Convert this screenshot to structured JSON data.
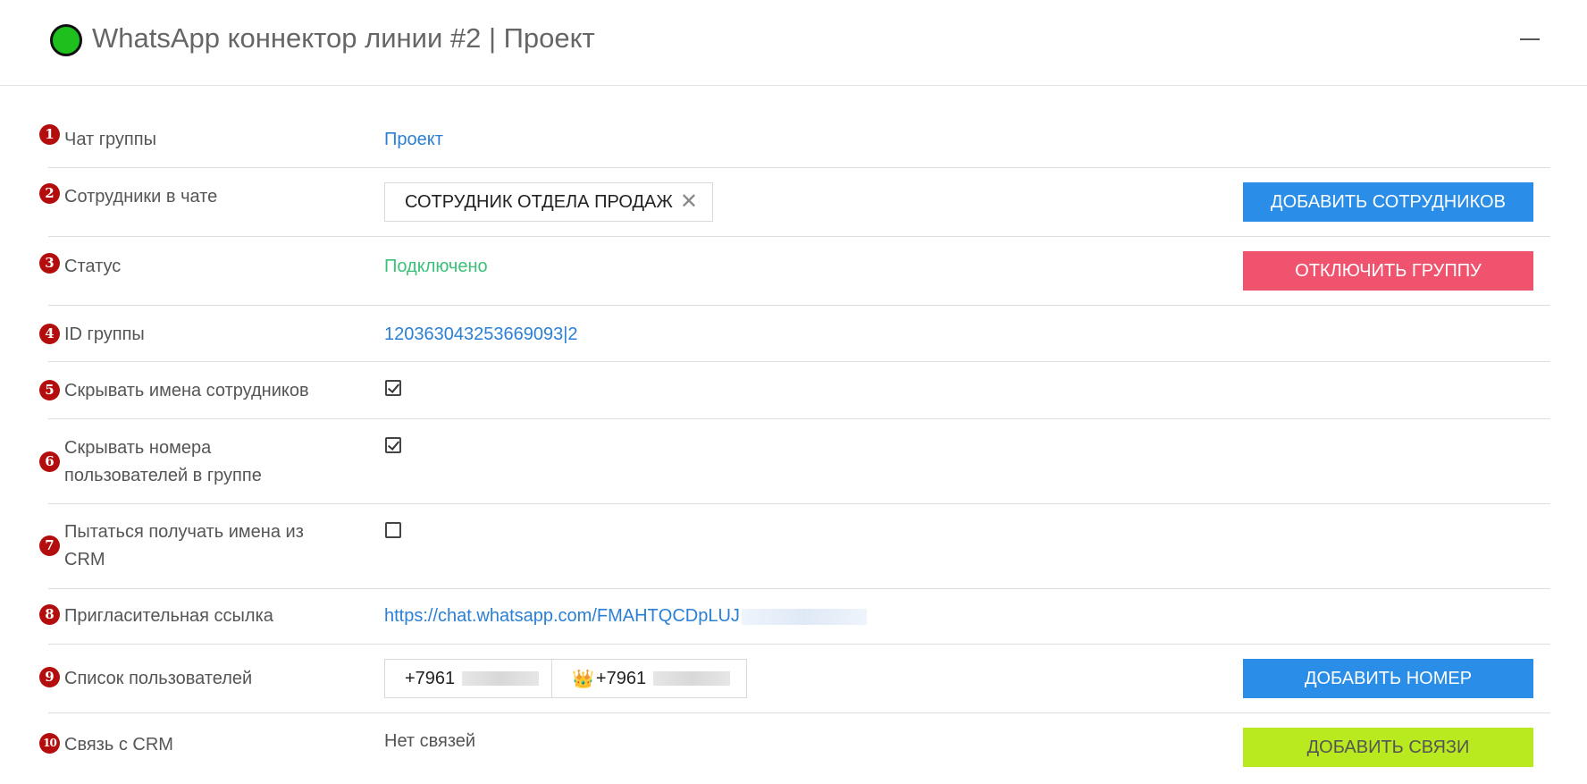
{
  "header": {
    "title": "WhatsApp коннектор линии #2 | Проект",
    "status_color": "#1ec01e",
    "minimize_icon": "minimize-icon"
  },
  "rows": {
    "chat_group": {
      "num": "1",
      "label": "Чат группы",
      "value": "Проект"
    },
    "employees": {
      "num": "2",
      "label": "Сотрудники в чате",
      "chip": "СОТРУДНИК ОТДЕЛА ПРОДАЖ",
      "button": "ДОБАВИТЬ СОТРУДНИКОВ"
    },
    "status": {
      "num": "3",
      "label": "Статус",
      "value": "Подключено",
      "button": "ОТКЛЮЧИТЬ ГРУППУ"
    },
    "group_id": {
      "num": "4",
      "label": "ID группы",
      "value": "120363043253669093|2"
    },
    "hide_names": {
      "num": "5",
      "label": "Скрывать имена сотрудников",
      "checked": true
    },
    "hide_numbers": {
      "num": "6",
      "label": "Скрывать номера пользователей в группе",
      "checked": true
    },
    "crm_names": {
      "num": "7",
      "label": "Пытаться получать имена из CRM",
      "checked": false
    },
    "invite_link": {
      "num": "8",
      "label": "Пригласительная ссылка",
      "value": "https://chat.whatsapp.com/FMAHTQCDpLUJ"
    },
    "users": {
      "num": "9",
      "label": "Список пользователей",
      "phones": [
        "+7961",
        "+7961"
      ],
      "button": "ДОБАВИТЬ НОМЕР"
    },
    "crm_link": {
      "num": "10",
      "label": "Связь с CRM",
      "value": "Нет связей",
      "button": "ДОБАВИТЬ СВЯЗИ"
    }
  },
  "colors": {
    "accent_blue": "#2a8de8",
    "danger_red": "#f0536e",
    "lime": "#b9ea1f",
    "success_green": "#3cc17a",
    "link_blue": "#2b7fd4",
    "badge_red": "#b30d0d"
  }
}
